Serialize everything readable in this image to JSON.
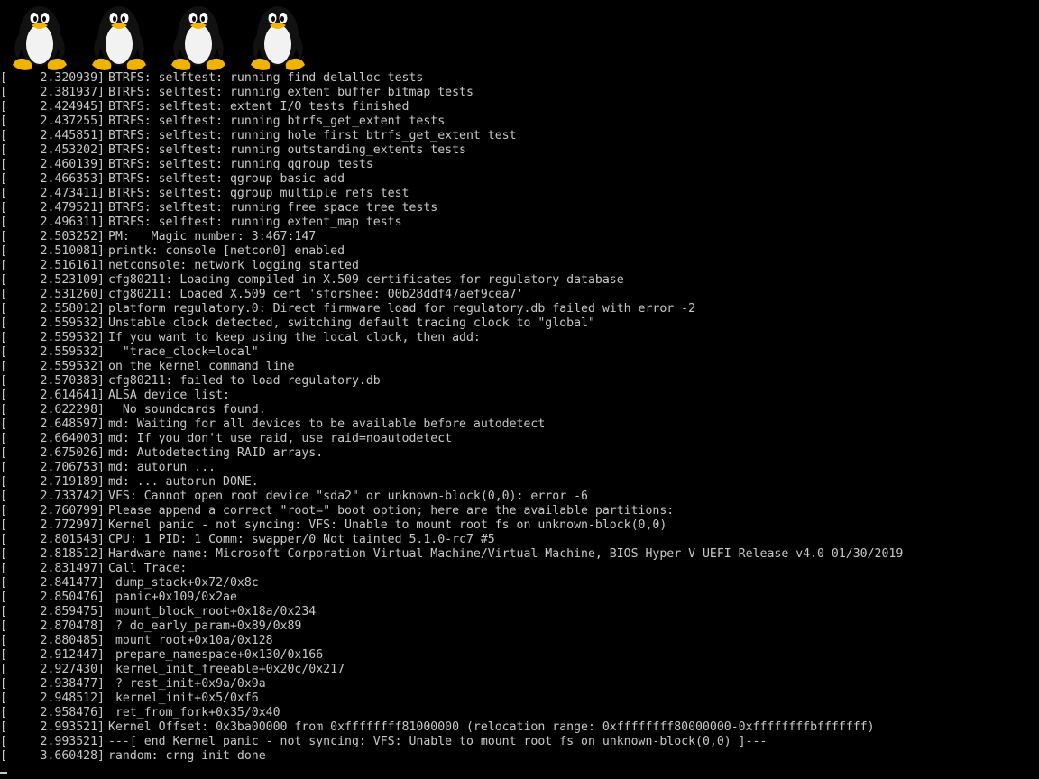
{
  "screen": {
    "colors": {
      "background": "#000000",
      "text": "#c8c8c8"
    },
    "logos": [
      {
        "icon": "tux-penguin-icon"
      },
      {
        "icon": "tux-penguin-icon"
      },
      {
        "icon": "tux-penguin-icon"
      },
      {
        "icon": "tux-penguin-icon"
      }
    ]
  },
  "console": {
    "lines": [
      {
        "ts": "2.320939]",
        "msg": "BTRFS: selftest: running find delalloc tests"
      },
      {
        "ts": "2.381937]",
        "msg": "BTRFS: selftest: running extent buffer bitmap tests"
      },
      {
        "ts": "2.424945]",
        "msg": "BTRFS: selftest: extent I/O tests finished"
      },
      {
        "ts": "2.437255]",
        "msg": "BTRFS: selftest: running btrfs_get_extent tests"
      },
      {
        "ts": "2.445851]",
        "msg": "BTRFS: selftest: running hole first btrfs_get_extent test"
      },
      {
        "ts": "2.453202]",
        "msg": "BTRFS: selftest: running outstanding_extents tests"
      },
      {
        "ts": "2.460139]",
        "msg": "BTRFS: selftest: running qgroup tests"
      },
      {
        "ts": "2.466353]",
        "msg": "BTRFS: selftest: qgroup basic add"
      },
      {
        "ts": "2.473411]",
        "msg": "BTRFS: selftest: qgroup multiple refs test"
      },
      {
        "ts": "2.479521]",
        "msg": "BTRFS: selftest: running free space tree tests"
      },
      {
        "ts": "2.496311]",
        "msg": "BTRFS: selftest: running extent_map tests"
      },
      {
        "ts": "2.503252]",
        "msg": "PM:   Magic number: 3:467:147"
      },
      {
        "ts": "2.510081]",
        "msg": "printk: console [netcon0] enabled"
      },
      {
        "ts": "2.516161]",
        "msg": "netconsole: network logging started"
      },
      {
        "ts": "2.523109]",
        "msg": "cfg80211: Loading compiled-in X.509 certificates for regulatory database"
      },
      {
        "ts": "2.531260]",
        "msg": "cfg80211: Loaded X.509 cert 'sforshee: 00b28ddf47aef9cea7'"
      },
      {
        "ts": "2.558012]",
        "msg": "platform regulatory.0: Direct firmware load for regulatory.db failed with error -2"
      },
      {
        "ts": "2.559532]",
        "msg": "Unstable clock detected, switching default tracing clock to \"global\""
      },
      {
        "ts": "2.559532]",
        "msg": "If you want to keep using the local clock, then add:"
      },
      {
        "ts": "2.559532]",
        "msg": "  \"trace_clock=local\""
      },
      {
        "ts": "2.559532]",
        "msg": "on the kernel command line"
      },
      {
        "ts": "2.570383]",
        "msg": "cfg80211: failed to load regulatory.db"
      },
      {
        "ts": "2.614641]",
        "msg": "ALSA device list:"
      },
      {
        "ts": "2.622298]",
        "msg": "  No soundcards found."
      },
      {
        "ts": "2.648597]",
        "msg": "md: Waiting for all devices to be available before autodetect"
      },
      {
        "ts": "2.664003]",
        "msg": "md: If you don't use raid, use raid=noautodetect"
      },
      {
        "ts": "2.675026]",
        "msg": "md: Autodetecting RAID arrays."
      },
      {
        "ts": "2.706753]",
        "msg": "md: autorun ..."
      },
      {
        "ts": "2.719189]",
        "msg": "md: ... autorun DONE."
      },
      {
        "ts": "2.733742]",
        "msg": "VFS: Cannot open root device \"sda2\" or unknown-block(0,0): error -6"
      },
      {
        "ts": "2.760799]",
        "msg": "Please append a correct \"root=\" boot option; here are the available partitions:"
      },
      {
        "ts": "2.772997]",
        "msg": "Kernel panic - not syncing: VFS: Unable to mount root fs on unknown-block(0,0)"
      },
      {
        "ts": "2.801543]",
        "msg": "CPU: 1 PID: 1 Comm: swapper/0 Not tainted 5.1.0-rc7 #5"
      },
      {
        "ts": "2.818512]",
        "msg": "Hardware name: Microsoft Corporation Virtual Machine/Virtual Machine, BIOS Hyper-V UEFI Release v4.0 01/30/2019"
      },
      {
        "ts": "2.831497]",
        "msg": "Call Trace:"
      },
      {
        "ts": "2.841477]",
        "msg": " dump_stack+0x72/0x8c"
      },
      {
        "ts": "2.850476]",
        "msg": " panic+0x109/0x2ae"
      },
      {
        "ts": "2.859475]",
        "msg": " mount_block_root+0x18a/0x234"
      },
      {
        "ts": "2.870478]",
        "msg": " ? do_early_param+0x89/0x89"
      },
      {
        "ts": "2.880485]",
        "msg": " mount_root+0x10a/0x128"
      },
      {
        "ts": "2.912447]",
        "msg": " prepare_namespace+0x130/0x166"
      },
      {
        "ts": "2.927430]",
        "msg": " kernel_init_freeable+0x20c/0x217"
      },
      {
        "ts": "2.938477]",
        "msg": " ? rest_init+0x9a/0x9a"
      },
      {
        "ts": "2.948512]",
        "msg": " kernel_init+0x5/0xf6"
      },
      {
        "ts": "2.958476]",
        "msg": " ret_from_fork+0x35/0x40"
      },
      {
        "ts": "2.993521]",
        "msg": "Kernel Offset: 0x3ba00000 from 0xffffffff81000000 (relocation range: 0xffffffff80000000-0xffffffffbfffffff)"
      },
      {
        "ts": "2.993521]",
        "msg": "---[ end Kernel panic - not syncing: VFS: Unable to mount root fs on unknown-block(0,0) ]---"
      },
      {
        "ts": "3.660428]",
        "msg": "random: crng init done"
      }
    ]
  }
}
